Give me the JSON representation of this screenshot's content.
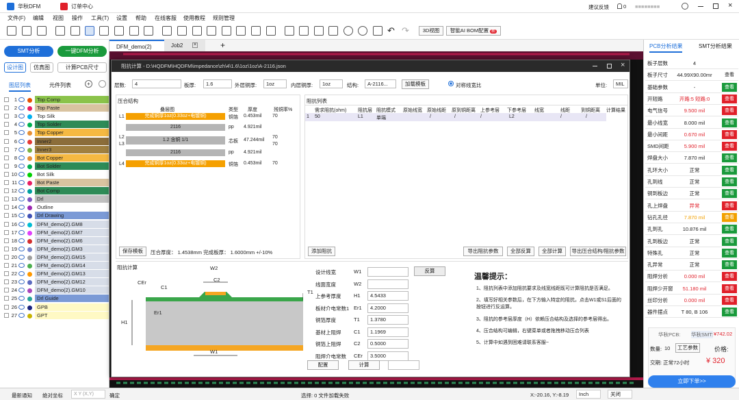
{
  "app": {
    "title": "华秋DFM",
    "tab_orders": "订单中心",
    "feedback": "建议反馈",
    "notif_count": "0",
    "user": "■■■■■■■■"
  },
  "menu": [
    "文件(F)",
    "编辑",
    "视图",
    "操作",
    "工具(T)",
    "设置",
    "帮助",
    "在线客服",
    "使用教程",
    "规则管理"
  ],
  "toolbar": {
    "view3d": "3D视图",
    "ai_bom": "智能AI BOM配置",
    "ai_badge": "新"
  },
  "left": {
    "smt_btn": "SMT分析",
    "dfm_btn": "一键DFM分析",
    "tabs": [
      "设计图",
      "仿真图"
    ],
    "calc_btn": "计算PCB尺寸",
    "subtabs": [
      "图层列表",
      "元件列表"
    ],
    "layers": [
      {
        "n": "1",
        "name": "Top Comp",
        "bg": "#8bc34a",
        "dot": "#e65100"
      },
      {
        "n": "2",
        "name": "Top Paste",
        "bg": "#d9c3a0",
        "dot": "#e91e63"
      },
      {
        "n": "3",
        "name": "Top Silk",
        "bg": "#ffffff",
        "dot": "#00b0f0"
      },
      {
        "n": "4",
        "name": "Top Solder",
        "bg": "#2e8b57",
        "dot": "#00b050"
      },
      {
        "n": "5",
        "name": "Top Copper",
        "bg": "#f5b942",
        "dot": "#e69138"
      },
      {
        "n": "6",
        "name": "Inner2",
        "bg": "#8b6d3a",
        "dot": "#e53935"
      },
      {
        "n": "7",
        "name": "Inner3",
        "bg": "#a08040",
        "dot": "#7cb342"
      },
      {
        "n": "8",
        "name": "Bot Copper",
        "bg": "#f5b942",
        "dot": "#e69138"
      },
      {
        "n": "9",
        "name": "Bot Solder",
        "bg": "#2e8b57",
        "dot": "#00b050"
      },
      {
        "n": "10",
        "name": "Bot Silk",
        "bg": "#ffffff",
        "dot": "#00d000"
      },
      {
        "n": "11",
        "name": "Bot Paste",
        "bg": "#d9c3a0",
        "dot": "#e91e63"
      },
      {
        "n": "12",
        "name": "Bot Comp",
        "bg": "#2e8b57",
        "dot": "#00a0a0"
      },
      {
        "n": "13",
        "name": "Drl",
        "bg": "#c0c0c0",
        "dot": "#7e57c2"
      },
      {
        "n": "14",
        "name": "Outline",
        "bg": "#ffffff",
        "dot": "#9c27b0"
      },
      {
        "n": "15",
        "name": "Drl Drawing",
        "bg": "#7b9ad6",
        "dot": "#3f51b5"
      },
      {
        "n": "16",
        "name": "DFM_demo(2).GM8",
        "bg": "#d7dde8",
        "dot": "#00bcd4"
      },
      {
        "n": "17",
        "name": "DFM_demo(2).GM7",
        "bg": "#d7dde8",
        "dot": "#e040fb"
      },
      {
        "n": "18",
        "name": "DFM_demo(2).GM6",
        "bg": "#d7dde8",
        "dot": "#d32f2f"
      },
      {
        "n": "19",
        "name": "DFM_demo(2).GM3",
        "bg": "#d7dde8",
        "dot": "#7986cb"
      },
      {
        "n": "20",
        "name": "DFM_demo(2).GM15",
        "bg": "#d7dde8",
        "dot": "#9e9e9e"
      },
      {
        "n": "21",
        "name": "DFM_demo(2).GM14",
        "bg": "#d7dde8",
        "dot": "#4caf50"
      },
      {
        "n": "22",
        "name": "DFM_demo(2).GM13",
        "bg": "#d7dde8",
        "dot": "#ff9800"
      },
      {
        "n": "23",
        "name": "DFM_demo(2).GM12",
        "bg": "#d7dde8",
        "dot": "#5c6bc0"
      },
      {
        "n": "24",
        "name": "DFM_demo(2).GM10",
        "bg": "#d7dde8",
        "dot": "#ab47bc"
      },
      {
        "n": "25",
        "name": "Drl Guide",
        "bg": "#7b9ad6",
        "dot": "#26a69a"
      },
      {
        "n": "26",
        "name": "GPB",
        "bg": "#fff9c4",
        "dot": "#1a237e"
      },
      {
        "n": "27",
        "name": "GPT",
        "bg": "#fff9c4",
        "dot": "#c8b400"
      }
    ]
  },
  "doc_tabs": [
    "DFM_demo(2)",
    "Job2"
  ],
  "dialog": {
    "title": "阻抗计算 - D:\\HQDFM\\HQDFM\\impedance\\zh\\4\\1.6\\1oz\\1oz\\A-2116.json",
    "layers_label": "层数:",
    "layers_val": "4",
    "thick_label": "板厚:",
    "thick_val": "1.6",
    "outer_label": "外层铜厚:",
    "outer_val": "1oz",
    "inner_label": "内层铜厚:",
    "inner_val": "1oz",
    "struct_label": "结构:",
    "struct_val": "A-2116...",
    "load_tpl": "加载模板",
    "symmetric": "对称线宽比",
    "unit_label": "单位:",
    "unit_val": "MIL",
    "stack_title": "压合结构",
    "stack_headers": [
      "叠层图",
      "类型",
      "厚度",
      "残铜率%"
    ],
    "stack_rows": [
      {
        "l": "L1",
        "img": "完成铜厚1oz(0.33oz+电镀铜)",
        "type": "铜箔",
        "th": "0.453mil",
        "r": "70"
      },
      {
        "l": "",
        "img": "2116",
        "type": "pp",
        "th": "4.921mil",
        "r": ""
      },
      {
        "l": "L2",
        "l2": "L3",
        "img": "1.2 含铜 1/1",
        "type": "芯板",
        "th": "47.244mil",
        "r": "70",
        "r2": "70"
      },
      {
        "l": "",
        "img": "2116",
        "type": "pp",
        "th": "4.921mil",
        "r": ""
      },
      {
        "l": "L4",
        "img": "完成铜厚1oz(0.33oz+电镀铜)",
        "type": "铜箔",
        "th": "0.453mil",
        "r": "70"
      }
    ],
    "save_tpl": "保存模板",
    "press_thick": "压合厚度： 1.4538mm 完成板厚： 1.6000mm +/-10%",
    "imp_title": "阻抗列表",
    "imp_headers": [
      "需求阻抗(ohm)",
      "阻抗层",
      "阻抗模式",
      "原始线宽",
      "原始线距",
      "原到铜距离",
      "上参考层",
      "下参考层",
      "线宽",
      "线距",
      "到铜距离",
      "计算结果"
    ],
    "imp_row": {
      "idx": "1",
      "ohm": "50",
      "layer": "L1",
      "mode": "单端",
      "w": "",
      "d": "/",
      "cu": "/",
      "up": "/",
      "down": "L2",
      "lw": "",
      "ld": "/",
      "lcu": "/",
      "res": ""
    },
    "add_imp": "添加阻抗",
    "export_imp": "导出阻抗参数",
    "all_reverse": "全部反算",
    "all_calc": "全部计算",
    "export_stack": "导出压合结构/阻抗参数",
    "calc_title": "阻抗计算",
    "params": [
      {
        "k": "设计线宽",
        "s": "W1",
        "v": ""
      },
      {
        "k": "线面宽度",
        "s": "W2",
        "v": ""
      },
      {
        "k": "上参考厚度",
        "s": "H1",
        "v": "4.5433"
      },
      {
        "k": "板材介电常数1",
        "s": "Er1",
        "v": "4.2000"
      },
      {
        "k": "铜箔厚度",
        "s": "T1",
        "v": "1.3780"
      },
      {
        "k": "基材上阻焊",
        "s": "C1",
        "v": "1.1969"
      },
      {
        "k": "铜箔上阻焊",
        "s": "C2",
        "v": "0.5000"
      },
      {
        "k": "阻焊介电常数",
        "s": "CEr",
        "v": "3.5000"
      }
    ],
    "reverse_btn": "反算",
    "cfg_btn": "配置",
    "calc_btn": "计算",
    "diag_labels": {
      "w2": "W2",
      "c2": "C2",
      "cer": "CEr",
      "c1": "C1",
      "t1": "T1",
      "h1": "H1",
      "er1": "Er1",
      "w1": "W1"
    },
    "tips_title": "温馨提示：",
    "tips": [
      "1、阻抗列表中添加阻抗要求及线宽线距既可计算阻抗是否满足。",
      "2、填写好相关参数后，在下方输入特定的阻抗，点击W1或S1后面的按钮进行反运算。",
      "3、阻抗的参考层厚度（H）依赖压合结构及选择的参考层得出。",
      "4、压合结构可编辑，右键菜单或者拖拽移动压合列表",
      "5、计算中如遇到困难请联系客服~"
    ]
  },
  "right": {
    "tabs": [
      "PCB分析结果",
      "SMT分析结果"
    ],
    "rows": [
      {
        "k": "板子层数",
        "v": "4",
        "c": "",
        "b": "",
        "bc": ""
      },
      {
        "k": "板子尺寸",
        "v": "44.99X90.00mr",
        "c": "",
        "b": "查看",
        "bc": "plain"
      },
      {
        "k": "基础参数",
        "v": "-",
        "c": "",
        "b": "查看",
        "bc": "#1a9a3c"
      },
      {
        "k": "开短路",
        "v": "开路:5 短路:0",
        "c": "red",
        "b": "查看",
        "bc": "#e0202a"
      },
      {
        "k": "电气信号",
        "v": "9.500 mil",
        "c": "red",
        "b": "查看",
        "bc": "#e0202a"
      },
      {
        "k": "最小线宽",
        "v": "8.000 mil",
        "c": "",
        "b": "查看",
        "bc": "#1a9a3c"
      },
      {
        "k": "最小间距",
        "v": "0.670 mil",
        "c": "red",
        "b": "查看",
        "bc": "#e0202a"
      },
      {
        "k": "SMD间距",
        "v": "5.900 mil",
        "c": "red",
        "b": "查看",
        "bc": "#e0202a"
      },
      {
        "k": "焊盘大小",
        "v": "7.870 mil",
        "c": "",
        "b": "查看",
        "bc": "#1a9a3c"
      },
      {
        "k": "孔环大小",
        "v": "正常",
        "c": "",
        "b": "查看",
        "bc": "#1a9a3c"
      },
      {
        "k": "孔到线",
        "v": "正常",
        "c": "",
        "b": "查看",
        "bc": "#1a9a3c"
      },
      {
        "k": "铜到板边",
        "v": "正常",
        "c": "",
        "b": "查看",
        "bc": "#1a9a3c"
      },
      {
        "k": "孔上焊盘",
        "v": "异常",
        "c": "red",
        "b": "查看",
        "bc": "#e0202a"
      },
      {
        "k": "钻孔孔径",
        "v": "7.870 mil",
        "c": "orange",
        "b": "查看",
        "bc": "#f2a000"
      },
      {
        "k": "孔到孔",
        "v": "10.876 mil",
        "c": "",
        "b": "查看",
        "bc": "#1a9a3c"
      },
      {
        "k": "孔到板边",
        "v": "正常",
        "c": "",
        "b": "查看",
        "bc": "#1a9a3c"
      },
      {
        "k": "特殊孔",
        "v": "正常",
        "c": "",
        "b": "查看",
        "bc": "#1a9a3c"
      },
      {
        "k": "孔异常",
        "v": "正常",
        "c": "",
        "b": "查看",
        "bc": "#1a9a3c"
      },
      {
        "k": "阻焊分析",
        "v": "0.000 mil",
        "c": "red",
        "b": "查看",
        "bc": "#e0202a"
      },
      {
        "k": "阻焊少开窗",
        "v": "51.180 mil",
        "c": "red",
        "b": "查看",
        "bc": "#e0202a"
      },
      {
        "k": "丝印分析",
        "v": "0.000 mil",
        "c": "red",
        "b": "查看",
        "bc": "#e0202a"
      },
      {
        "k": "器件摆点",
        "v": "T 80, B 106",
        "c": "",
        "b": "查看",
        "bc": "#1a9a3c"
      }
    ],
    "pcb_label": "华秋PCB:",
    "smt_label": "华秋SMT:",
    "smt_price": "¥742.02",
    "qty_label": "数量:",
    "qty": "10",
    "craft": "工艺参数",
    "price_label": "价格:",
    "delivery": "交期: 正常72小时",
    "price": "¥ 320",
    "order_btn": "立即下单>>"
  },
  "status": {
    "news": "最新通知",
    "abs": "绝对坐标",
    "xy": "X Y (X,Y)",
    "ok": "确定",
    "select": "选择: 0 文件加载失败",
    "coords": "X:-20.16, Y:-8.19",
    "unit": "Inch",
    "off": "关闭"
  }
}
